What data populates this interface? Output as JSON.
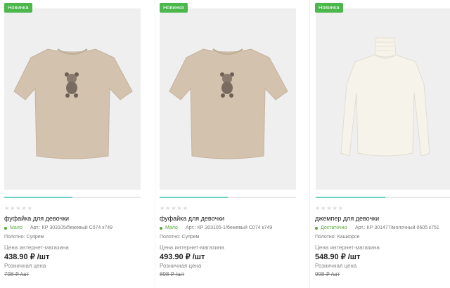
{
  "products": [
    {
      "badge": "Новинка",
      "name": "фуфайка для девочки",
      "stock": "Мало",
      "article": "Арт.: КР 303105/бежевый С074 к749",
      "fabric": "Полотно: Супрем",
      "net_label": "Цена интернет-магазина",
      "net_price": "438.90 ₽ /шт",
      "retail_label": "Розничная цена",
      "retail_price": "798 ₽ /шт",
      "rating_stars": "★★★★★",
      "image_icon": "tshirt-bear",
      "gallery_position": 0.5
    },
    {
      "badge": "Новинка",
      "name": "фуфайка для девочки",
      "stock": "Мало",
      "article": "Арт.: КР 303105-1/бежевый С074 к749",
      "fabric": "Полотно: Супрем",
      "net_label": "Цена интернет-магазина",
      "net_price": "493.90 ₽ /шт",
      "retail_label": "Розничная цена",
      "retail_price": "898 ₽ /шт",
      "rating_stars": "★★★★★",
      "image_icon": "tshirt-bear",
      "gallery_position": 0.5
    },
    {
      "badge": "Новинка",
      "name": "джемпер для девочки",
      "stock": "Достаточно",
      "article": "Арт.: КР 301477/молочный 0605 к751",
      "fabric": "Полотно: Кашкорсе",
      "net_label": "Цена интернет-магазина",
      "net_price": "548.90 ₽ /шт",
      "retail_label": "Розничная цена",
      "retail_price": "998 ₽ /шт",
      "rating_stars": "★★★★★",
      "image_icon": "turtleneck",
      "gallery_position": 0.5
    }
  ],
  "colors": {
    "badge": "#4cb84c",
    "stock": "#58a83a",
    "slider": "#6fd0c8",
    "shirt": "#d3c2ad",
    "turtleneck": "#f6f3ea"
  }
}
